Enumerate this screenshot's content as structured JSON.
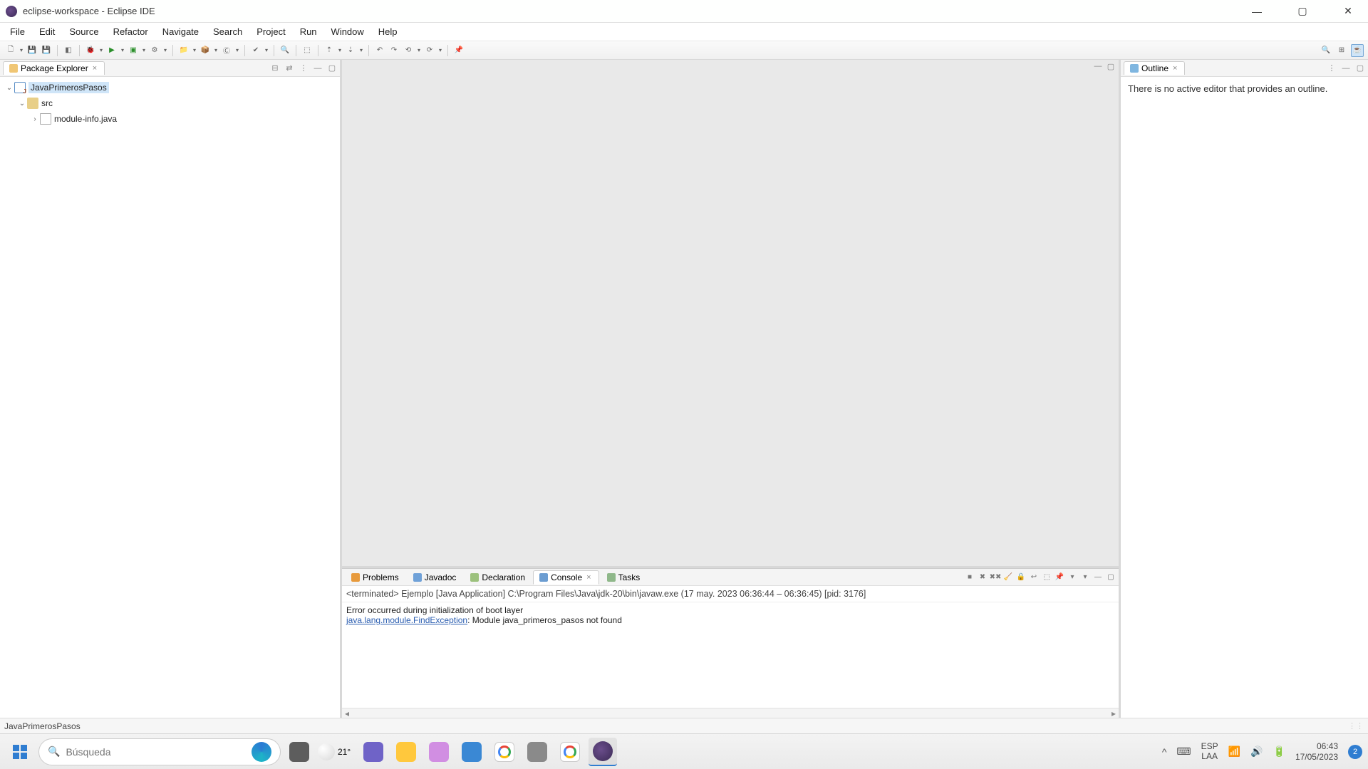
{
  "title": "eclipse-workspace - Eclipse IDE",
  "menu": [
    "File",
    "Edit",
    "Source",
    "Refactor",
    "Navigate",
    "Search",
    "Project",
    "Run",
    "Window",
    "Help"
  ],
  "views": {
    "package_explorer": {
      "title": "Package Explorer",
      "tree": {
        "project": "JavaPrimerosPasos",
        "src": "src",
        "module_info": "module-info.java"
      }
    },
    "outline": {
      "title": "Outline",
      "empty_msg": "There is no active editor that provides an outline."
    }
  },
  "bottom_tabs": {
    "problems": "Problems",
    "javadoc": "Javadoc",
    "declaration": "Declaration",
    "console": "Console",
    "tasks": "Tasks"
  },
  "console": {
    "header": "<terminated> Ejemplo [Java Application] C:\\Program Files\\Java\\jdk-20\\bin\\javaw.exe  (17 may. 2023 06:36:44 – 06:36:45) [pid: 3176]",
    "line1": "Error occurred during initialization of boot layer",
    "exception": "java.lang.module.FindException",
    "line2_rest": ": Module java_primeros_pasos not found"
  },
  "status": "JavaPrimerosPasos",
  "taskbar": {
    "search_placeholder": "Búsqueda",
    "weather_temp": "21°",
    "lang1": "ESP",
    "lang2": "LAA",
    "time": "06:43",
    "date": "17/05/2023",
    "notif": "2"
  }
}
